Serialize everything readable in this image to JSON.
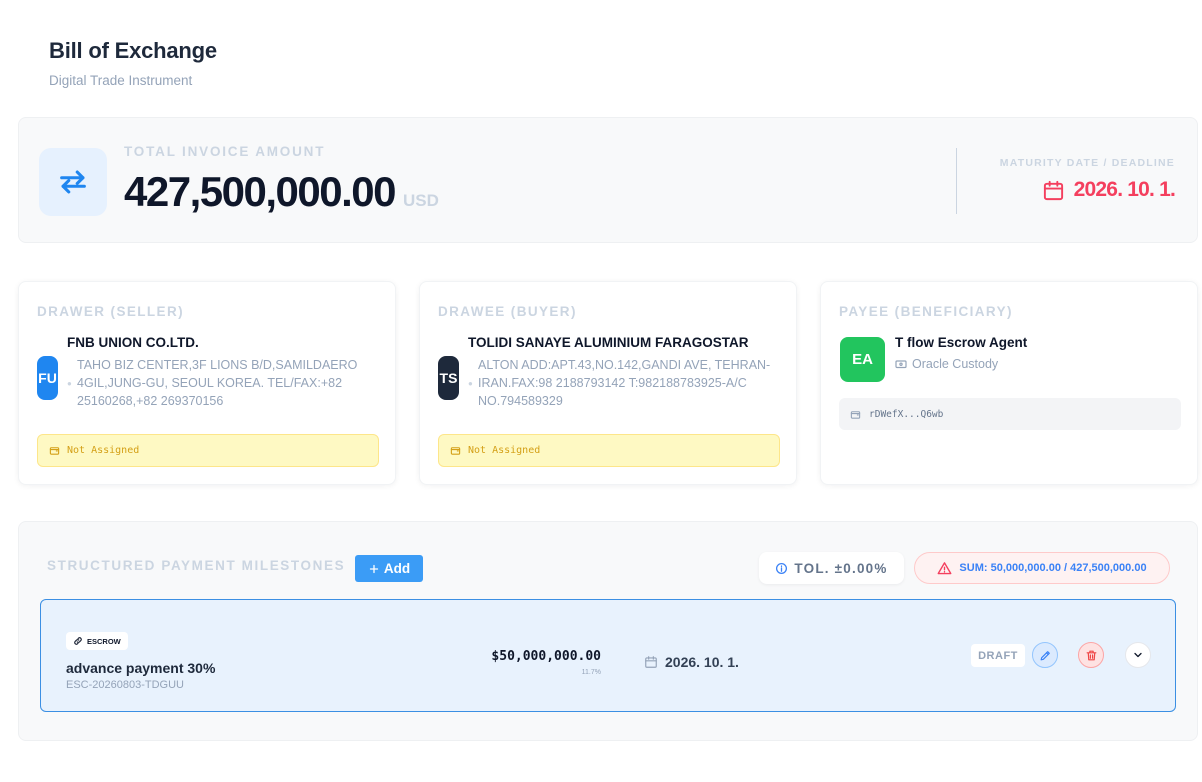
{
  "header": {
    "title": "Bill of Exchange",
    "subtitle": "Digital Trade Instrument"
  },
  "summary": {
    "total_label": "TOTAL INVOICE AMOUNT",
    "total_amount": "427,500,000.00",
    "currency": "USD",
    "maturity_label": "MATURITY DATE / DEADLINE",
    "maturity_date": "2026. 10. 1.",
    "accent_color": "#f43f5e"
  },
  "drawer": {
    "label": "DRAWER (SELLER)",
    "initials": "FU",
    "avatar_color": "#1f86f0",
    "name": "FNB UNION CO.LTD.",
    "address": "TAHO BIZ CENTER,3F LIONS B/D,SAMILDAERO 4GIL,JUNG-GU, SEOUL KOREA. TEL/FAX:+82 25160268,+82 269370156",
    "wallet_status": "Not Assigned"
  },
  "drawee": {
    "label": "DRAWEE (BUYER)",
    "initials": "TS",
    "avatar_color": "#1e293b",
    "name": "TOLIDI SANAYE ALUMINIUM FARAGOSTAR",
    "address": "ALTON ADD:APT.43,NO.142,GANDI AVE, TEHRAN-IRAN.FAX:98 2188793142 T:982188783925-A/C NO.794589329",
    "wallet_status": "Not Assigned"
  },
  "payee": {
    "label": "PAYEE (BENEFICIARY)",
    "initials": "EA",
    "avatar_color": "#22c55e",
    "name": "T flow Escrow Agent",
    "custody": "Oracle Custody",
    "wallet_address": "rDWefX...Q6wb"
  },
  "milestones": {
    "title": "STRUCTURED PAYMENT MILESTONES",
    "add_label": "Add",
    "tolerance": "TOL. ±0.00%",
    "sum": "SUM: 50,000,000.00 / 427,500,000.00",
    "items": [
      {
        "type": "ESCROW",
        "name": "advance payment 30%",
        "id": "ESC-20260803-TDGUU",
        "amount": "$50,000,000.00",
        "percent": "11.7%",
        "date": "2026. 10. 1.",
        "status": "DRAFT"
      }
    ]
  }
}
